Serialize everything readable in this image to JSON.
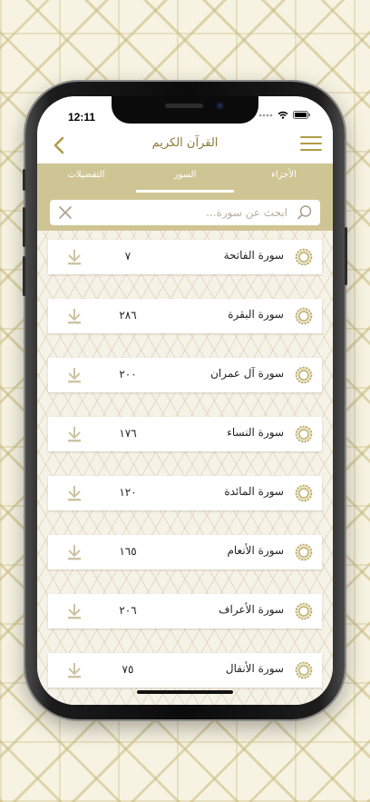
{
  "status": {
    "time": "12:11"
  },
  "header": {
    "title": "القرآن الكريم"
  },
  "tabs": [
    {
      "label": "الأجزاء"
    },
    {
      "label": "السور"
    },
    {
      "label": "التفضيلات"
    }
  ],
  "search": {
    "placeholder": "ابحث عن سورة..."
  },
  "surahs": [
    {
      "name": "سورة الفاتحة",
      "verses": "٧"
    },
    {
      "name": "سورة البقرة",
      "verses": "٢٨٦"
    },
    {
      "name": "سورة آل عمران",
      "verses": "٢٠٠"
    },
    {
      "name": "سورة النساء",
      "verses": "١٧٦"
    },
    {
      "name": "سورة المائدة",
      "verses": "١٢٠"
    },
    {
      "name": "سورة الأنعام",
      "verses": "١٦٥"
    },
    {
      "name": "سورة الأعراف",
      "verses": "٢٠٦"
    },
    {
      "name": "سورة الأنفال",
      "verses": "٧٥"
    }
  ],
  "colors": {
    "accent": "#b09b46",
    "tab_bar": "#cfc594",
    "title_text": "#8a7a36"
  },
  "icons": {
    "back": "chevron-left-icon",
    "menu": "hamburger-menu-icon",
    "search": "search-icon",
    "clear": "close-icon",
    "download": "download-icon",
    "ornament": "star-ornament-icon"
  }
}
